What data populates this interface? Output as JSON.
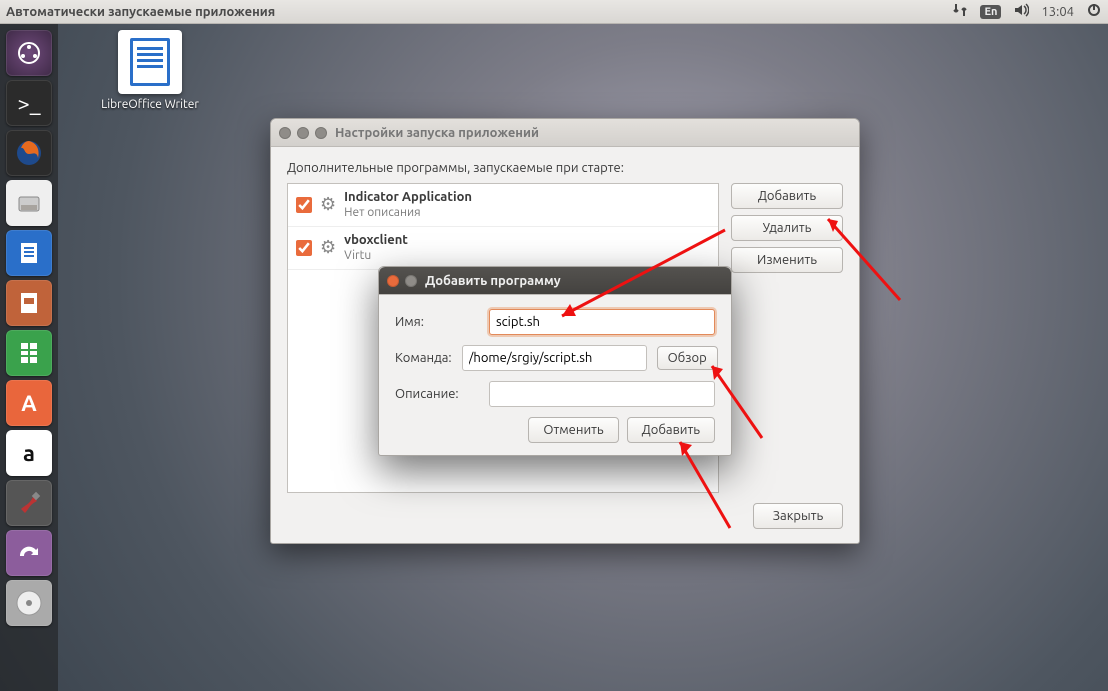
{
  "panel": {
    "app_title": "Автоматически запускаемые приложения",
    "lang": "En",
    "time": "13:04"
  },
  "desktop": {
    "writer_label": "LibreOffice Writer"
  },
  "launcher": {
    "dash": "⌕",
    "term": ">_",
    "sw": "A",
    "amz": "a"
  },
  "startup_window": {
    "title": "Настройки запуска приложений",
    "section": "Дополнительные программы, запускаемые при старте:",
    "rows": [
      {
        "name": "Indicator Application",
        "desc": "Нет описания",
        "checked": true
      },
      {
        "name": "vboxclient",
        "desc": "Virtu",
        "checked": true
      }
    ],
    "buttons": {
      "add": "Добавить",
      "remove": "Удалить",
      "edit": "Изменить",
      "close": "Закрыть"
    }
  },
  "add_dialog": {
    "title": "Добавить программу",
    "labels": {
      "name": "Имя:",
      "command": "Команда:",
      "comment": "Описание:"
    },
    "values": {
      "name": "scipt.sh",
      "command": "/home/srgiy/script.sh",
      "comment": ""
    },
    "browse": "Обзор",
    "cancel": "Отменить",
    "add": "Добавить"
  }
}
